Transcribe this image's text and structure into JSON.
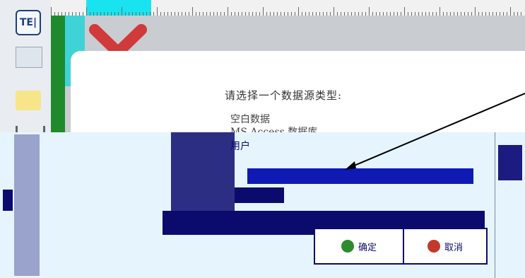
{
  "toolbar": {
    "te_label": "TE|"
  },
  "dialog": {
    "prompt": "请选择一个数据源类型:",
    "options": [
      {
        "label": "空白数据"
      },
      {
        "label": "MS Access 数据库"
      },
      {
        "label": "用户"
      }
    ],
    "ok_label": "确定",
    "cancel_label": "取消"
  },
  "colors": {
    "selection": "#0f1ab5",
    "panel": "#e6f4fd",
    "ruler_highlight": "#19e3ef",
    "delete_red": "#d03a3a"
  }
}
